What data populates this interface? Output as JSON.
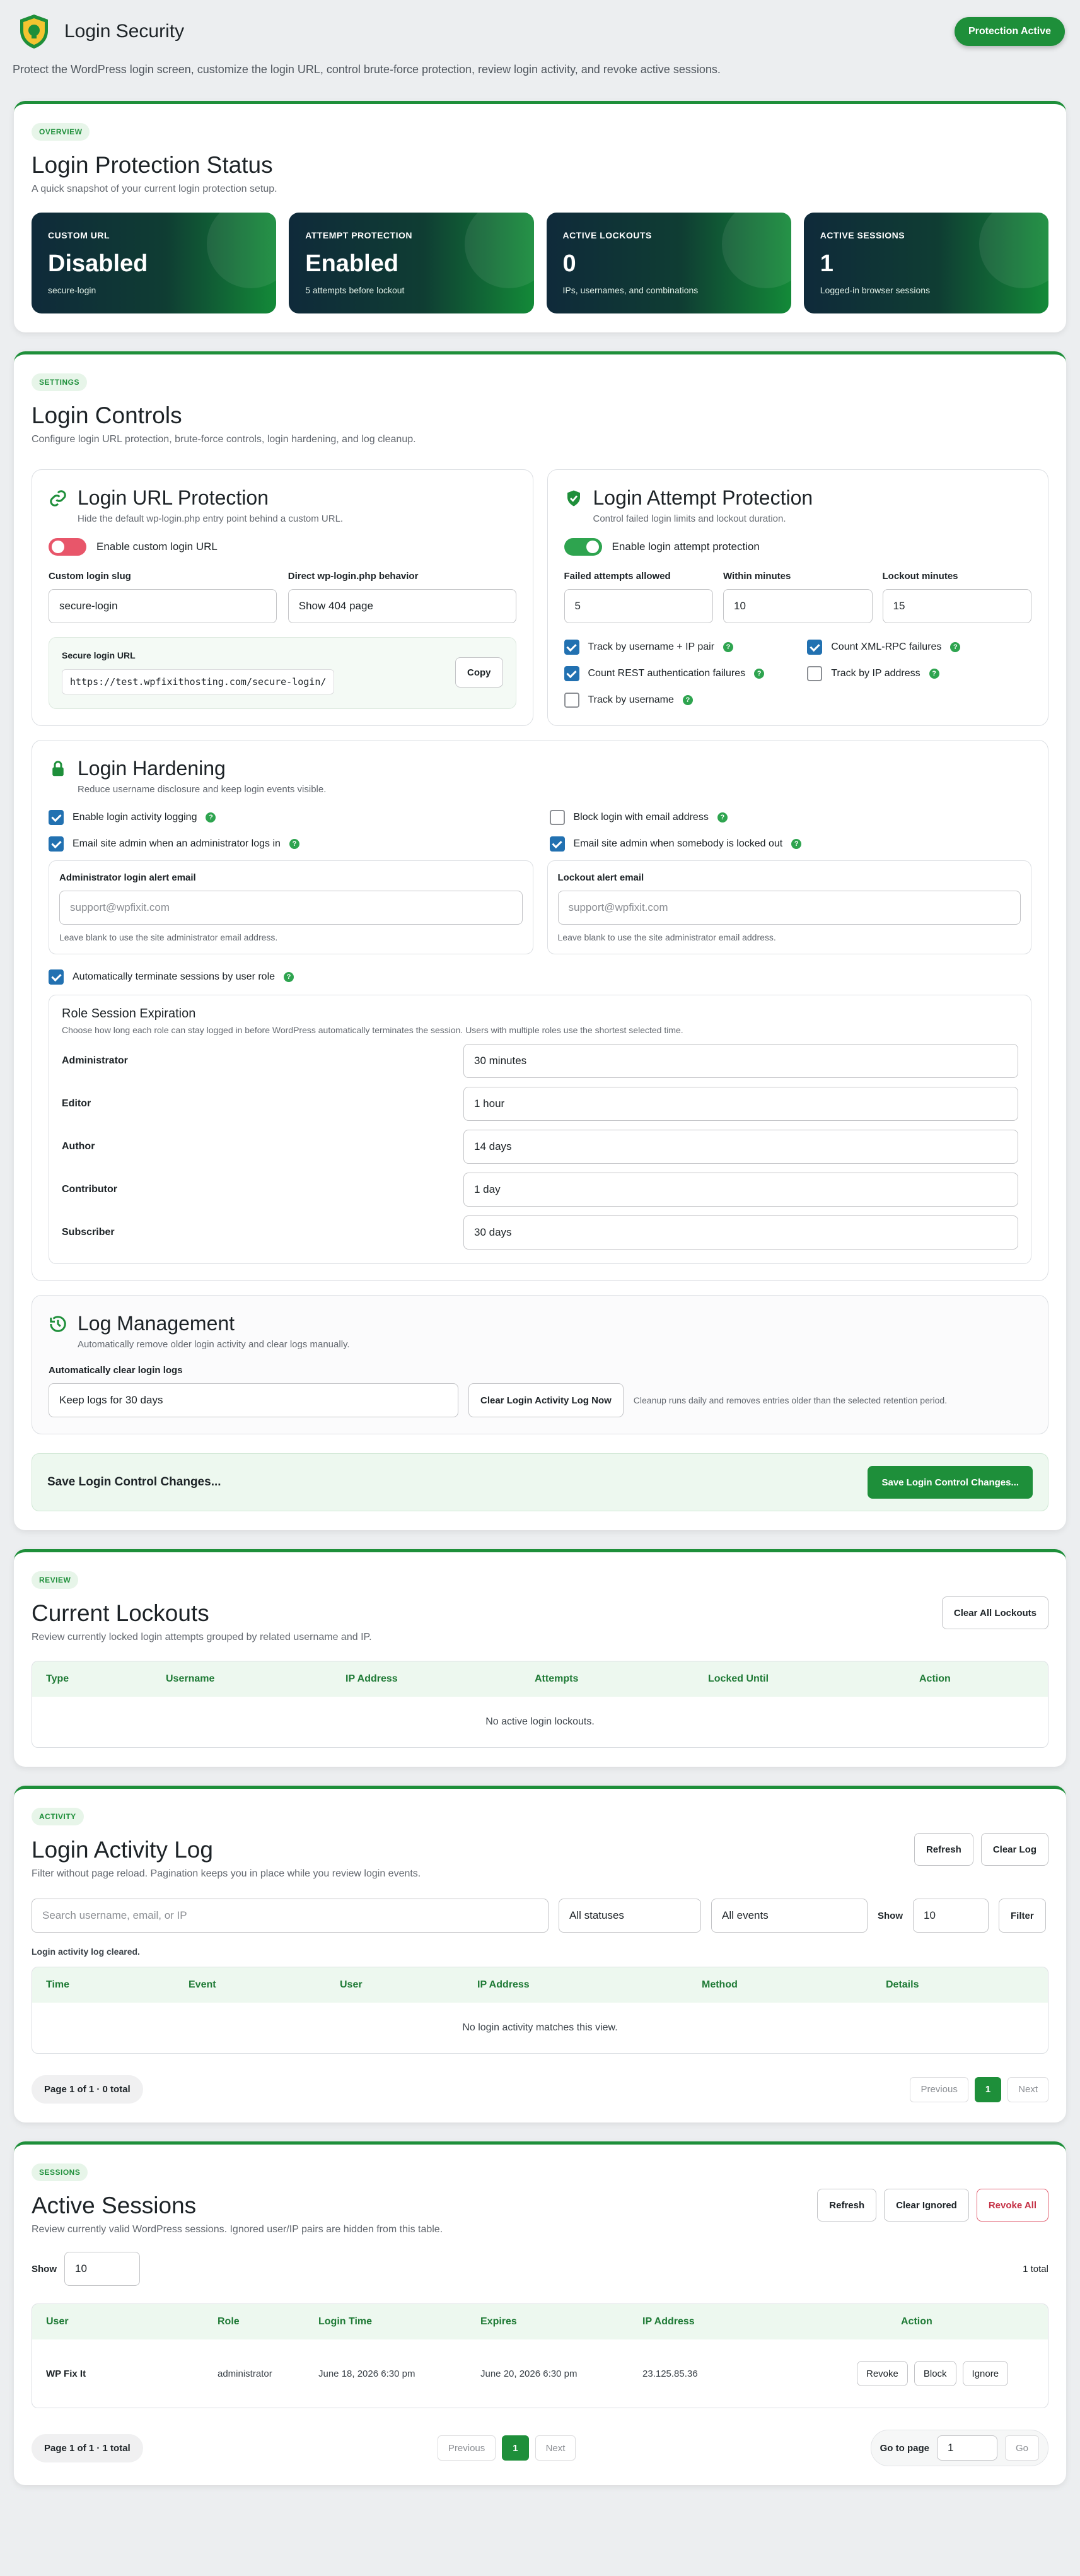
{
  "header": {
    "title": "Login Security",
    "status_badge": "Protection Active"
  },
  "intro": "Protect the WordPress login screen, customize the login URL, control brute-force protection, review login activity, and revoke active sessions.",
  "overview": {
    "tag": "OVERVIEW",
    "title": "Login Protection Status",
    "subtitle": "A quick snapshot of your current login protection setup.",
    "stats": [
      {
        "label": "CUSTOM URL",
        "value": "Disabled",
        "note": "secure-login"
      },
      {
        "label": "ATTEMPT PROTECTION",
        "value": "Enabled",
        "note": "5 attempts before lockout"
      },
      {
        "label": "ACTIVE LOCKOUTS",
        "value": "0",
        "note": "IPs, usernames, and combinations"
      },
      {
        "label": "ACTIVE SESSIONS",
        "value": "1",
        "note": "Logged-in browser sessions"
      }
    ]
  },
  "settings": {
    "tag": "SETTINGS",
    "title": "Login Controls",
    "subtitle": "Configure login URL protection, brute-force controls, login hardening, and log cleanup.",
    "url": {
      "title": "Login URL Protection",
      "subtitle": "Hide the default wp-login.php entry point behind a custom URL.",
      "toggle": "Enable custom login URL",
      "slug_label": "Custom login slug",
      "slug_value": "secure-login",
      "behavior_label": "Direct wp-login.php behavior",
      "behavior_value": "Show 404 page",
      "secure_label": "Secure login URL",
      "secure_url": "https://test.wpfixithosting.com/secure-login/",
      "copy": "Copy"
    },
    "attempt": {
      "title": "Login Attempt Protection",
      "subtitle": "Control failed login limits and lockout duration.",
      "toggle": "Enable login attempt protection",
      "failed_label": "Failed attempts allowed",
      "failed_value": "5",
      "within_label": "Within minutes",
      "within_value": "10",
      "lockout_label": "Lockout minutes",
      "lockout_value": "15",
      "checks": [
        "Track by username + IP pair",
        "Count XML-RPC failures",
        "Count REST authentication failures",
        "Track by IP address",
        "Track by username"
      ]
    },
    "hardening": {
      "title": "Login Hardening",
      "subtitle": "Reduce username disclosure and keep login events visible.",
      "checks": [
        "Enable login activity logging",
        "Block login with email address",
        "Email site admin when an administrator logs in",
        "Email site admin when somebody is locked out"
      ],
      "admin_email_label": "Administrator login alert email",
      "admin_email_ph": "support@wpfixit.com",
      "lock_email_label": "Lockout alert email",
      "lock_email_ph": "support@wpfixit.com",
      "email_hint": "Leave blank to use the site administrator email address.",
      "terminate": "Automatically terminate sessions by user role",
      "role_title": "Role Session Expiration",
      "role_sub": "Choose how long each role can stay logged in before WordPress automatically terminates the session. Users with multiple roles use the shortest selected time.",
      "roles": [
        {
          "name": "Administrator",
          "value": "30 minutes"
        },
        {
          "name": "Editor",
          "value": "1 hour"
        },
        {
          "name": "Author",
          "value": "14 days"
        },
        {
          "name": "Contributor",
          "value": "1 day"
        },
        {
          "name": "Subscriber",
          "value": "30 days"
        }
      ]
    },
    "logs": {
      "title": "Log Management",
      "subtitle": "Automatically remove older login activity and clear logs manually.",
      "label": "Automatically clear login logs",
      "value": "Keep logs for 30 days",
      "clear_btn": "Clear Login Activity Log Now",
      "hint": "Cleanup runs daily and removes entries older than the selected retention period."
    },
    "save_text": "Save Login Control Changes...",
    "save_btn": "Save Login Control Changes..."
  },
  "lockouts": {
    "tag": "REVIEW",
    "title": "Current Lockouts",
    "subtitle": "Review currently locked login attempts grouped by related username and IP.",
    "clear_btn": "Clear All Lockouts",
    "columns": [
      "Type",
      "Username",
      "IP Address",
      "Attempts",
      "Locked Until",
      "Action"
    ],
    "empty": "No active login lockouts."
  },
  "activity": {
    "tag": "ACTIVITY",
    "title": "Login Activity Log",
    "subtitle": "Filter without page reload. Pagination keeps you in place while you review login events.",
    "refresh": "Refresh",
    "clear": "Clear Log",
    "search_ph": "Search username, email, or IP",
    "statuses": "All statuses",
    "events": "All events",
    "show": "Show",
    "show_value": "10",
    "filter": "Filter",
    "message": "Login activity log cleared.",
    "columns": [
      "Time",
      "Event",
      "User",
      "IP Address",
      "Method",
      "Details"
    ],
    "empty": "No login activity matches this view.",
    "page_info": "Page 1 of 1 · 0 total",
    "prev": "Previous",
    "page": "1",
    "next": "Next"
  },
  "sessions": {
    "tag": "SESSIONS",
    "title": "Active Sessions",
    "subtitle": "Review currently valid WordPress sessions. Ignored user/IP pairs are hidden from this table.",
    "refresh": "Refresh",
    "clear_ignored": "Clear Ignored",
    "revoke_all": "Revoke All",
    "show": "Show",
    "show_value": "10",
    "total": "1 total",
    "columns": [
      "User",
      "Role",
      "Login Time",
      "Expires",
      "IP Address",
      "Action"
    ],
    "rows": [
      {
        "user": "WP Fix It",
        "role": "administrator",
        "login": "June 18, 2026 6:30 pm",
        "expires": "June 20, 2026 6:30 pm",
        "ip": "23.125.85.36"
      }
    ],
    "actions": [
      "Revoke",
      "Block",
      "Ignore"
    ],
    "page_info": "Page 1 of 1 · 1 total",
    "prev": "Previous",
    "page": "1",
    "next": "Next",
    "goto": "Go to page",
    "goto_value": "1",
    "go": "Go"
  },
  "colors": {
    "accent": "#1e8f3a",
    "danger": "#e8566a",
    "check": "#2271b1"
  }
}
